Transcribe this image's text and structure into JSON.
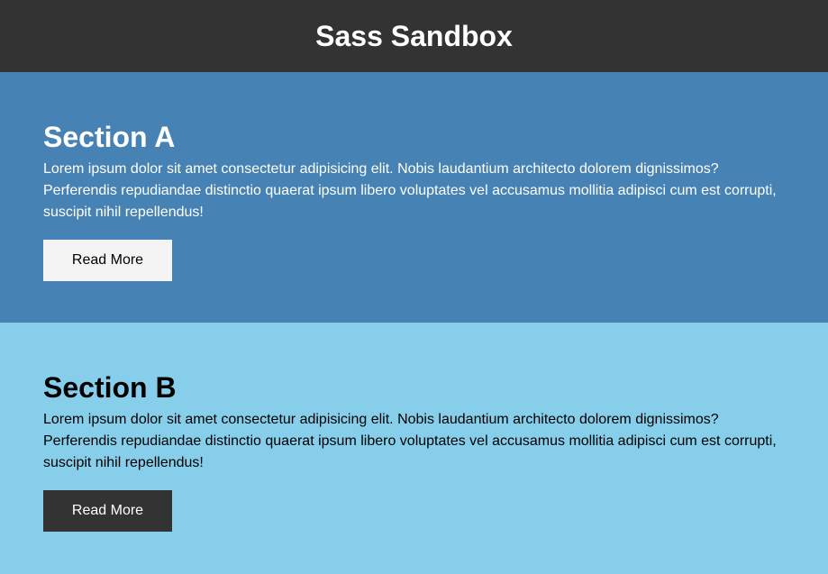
{
  "header": {
    "title": "Sass Sandbox"
  },
  "sections": [
    {
      "title": "Section A",
      "body": "Lorem ipsum dolor sit amet consectetur adipisicing elit. Nobis laudantium architecto dolorem dignissimos? Perferendis repudiandae distinctio quaerat ipsum libero voluptates vel accusamus mollitia adipisci cum est corrupti, suscipit nihil repellendus!",
      "button_label": "Read More",
      "background": "#4682b4",
      "text_color": "#ffffff",
      "button_background": "#f4f4f4",
      "button_text_color": "#000000"
    },
    {
      "title": "Section B",
      "body": "Lorem ipsum dolor sit amet consectetur adipisicing elit. Nobis laudantium architecto dolorem dignissimos? Perferendis repudiandae distinctio quaerat ipsum libero voluptates vel accusamus mollitia adipisci cum est corrupti, suscipit nihil repellendus!",
      "button_label": "Read More",
      "background": "#87ceeb",
      "text_color": "#000000",
      "button_background": "#333333",
      "button_text_color": "#ffffff"
    }
  ],
  "colors": {
    "header_background": "#333333",
    "header_text": "#ffffff"
  }
}
